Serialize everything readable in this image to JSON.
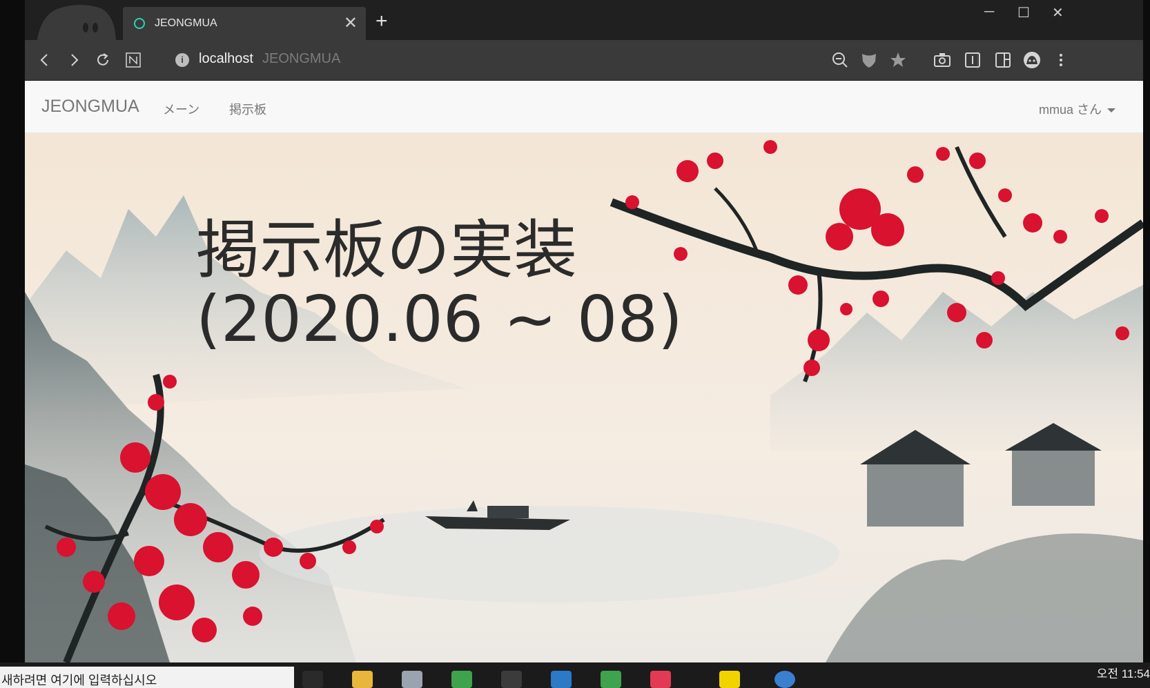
{
  "browser": {
    "tab": {
      "title": "JEONGMUA"
    },
    "address": {
      "host": "localhost",
      "page_title": "JEONGMUA"
    },
    "icons": {
      "back": "chevron-left-icon",
      "forward": "chevron-right-icon",
      "reload": "reload-icon",
      "notes": "notes-icon",
      "zoom": "zoom-out-icon",
      "shield": "shield-icon",
      "star": "star-icon",
      "capture": "camera-icon",
      "reader": "reader-view-icon",
      "sidebar": "sidebar-icon",
      "profile": "profile-avatar-icon",
      "menu": "kebab-menu-icon"
    }
  },
  "navbar": {
    "brand": "JEONGMUA",
    "links": [
      {
        "label": "メーン"
      },
      {
        "label": "掲示板"
      }
    ],
    "user": "mmua さん"
  },
  "hero": {
    "title_line1": "掲示板の実装",
    "title_line2": "(2020.06 ~ 08)"
  },
  "taskbar": {
    "search_text": "새하려면 여기에 입력하십시오",
    "clock": "오전 11:54"
  },
  "colors": {
    "tab_accent": "#2bd3b4",
    "navbar_bg": "#f8f8f8",
    "hero_bg": "#f5eee3",
    "blossom": "#d8122f"
  }
}
